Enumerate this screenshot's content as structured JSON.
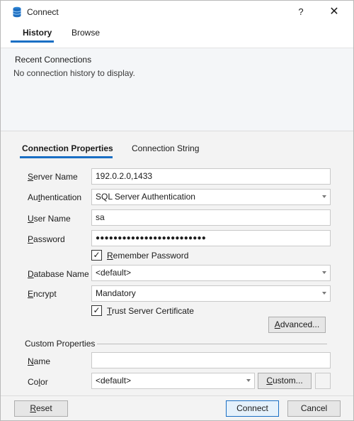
{
  "window": {
    "title": "Connect",
    "help_label": "?",
    "close_label": "✕"
  },
  "top_tabs": [
    {
      "label": "History",
      "active": true
    },
    {
      "label": "Browse",
      "active": false
    }
  ],
  "history": {
    "section_label": "Recent Connections",
    "empty_text": "No connection history to display."
  },
  "props_tabs": [
    {
      "label": "Connection Properties",
      "active": true
    },
    {
      "label": "Connection String",
      "active": false
    }
  ],
  "form": {
    "server_name": {
      "label_prefix": "",
      "label_u": "S",
      "label_rest": "erver Name",
      "value": "192.0.2.0,1433"
    },
    "authentication": {
      "label_prefix": "Au",
      "label_u": "t",
      "label_rest": "hentication",
      "value": "SQL Server Authentication"
    },
    "user_name": {
      "label_prefix": "",
      "label_u": "U",
      "label_rest": "ser Name",
      "value": "sa"
    },
    "password": {
      "label_prefix": "",
      "label_u": "P",
      "label_rest": "assword",
      "value": "●●●●●●●●●●●●●●●●●●●●●●●●●"
    },
    "remember_password": {
      "label_prefix": "",
      "label_u": "R",
      "label_rest": "emember Password",
      "checked": true,
      "mark": "✓"
    },
    "database_name": {
      "label_prefix": "",
      "label_u": "D",
      "label_rest": "atabase Name",
      "value": "<default>"
    },
    "encrypt": {
      "label_prefix": "",
      "label_u": "E",
      "label_rest": "ncrypt",
      "value": "Mandatory"
    },
    "trust_cert": {
      "label_prefix": "",
      "label_u": "T",
      "label_rest": "rust Server Certificate",
      "checked": true,
      "mark": "✓"
    },
    "advanced_button": {
      "label_prefix": "",
      "label_u": "A",
      "label_rest": "dvanced..."
    }
  },
  "custom": {
    "section_label": "Custom Properties",
    "name": {
      "label_prefix": "",
      "label_u": "N",
      "label_rest": "ame",
      "value": ""
    },
    "color": {
      "label_prefix": "Co",
      "label_u": "l",
      "label_rest": "or",
      "value": "<default>"
    },
    "custom_button": {
      "label_prefix": "",
      "label_u": "C",
      "label_rest": "ustom..."
    }
  },
  "footer": {
    "reset": {
      "label_prefix": "",
      "label_u": "R",
      "label_rest": "eset"
    },
    "connect_label": "Connect",
    "cancel_label": "Cancel"
  },
  "icons": {
    "app": "database-icon",
    "dropdown": "chevron-down-icon"
  },
  "colors": {
    "accent": "#1a6fc4",
    "history_bg": "#f4f6f8",
    "panel_bg": "#f3f3f3"
  }
}
